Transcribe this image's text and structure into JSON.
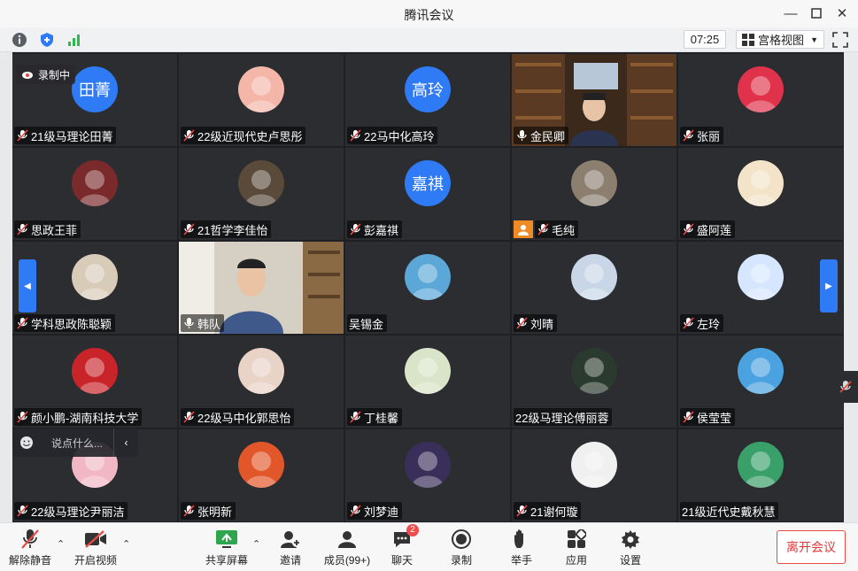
{
  "window": {
    "title": "腾讯会议"
  },
  "toolbar": {
    "timer": "07:25",
    "view_label": "宫格视图"
  },
  "recording": {
    "label": "录制中"
  },
  "chat": {
    "placeholder": "说点什么..."
  },
  "participants": [
    {
      "name": "21级马理论田菁",
      "avatar_text": "田菁",
      "kind": "text",
      "mic": "muted"
    },
    {
      "name": "22级近现代史卢思彤",
      "avatar_text": "",
      "kind": "photo",
      "color": "#f4b6a8",
      "mic": "muted"
    },
    {
      "name": "22马中化高玲",
      "avatar_text": "高玲",
      "kind": "text",
      "mic": "muted"
    },
    {
      "name": "金民卿",
      "avatar_text": "",
      "kind": "video",
      "mic": "on"
    },
    {
      "name": "张丽",
      "avatar_text": "",
      "kind": "photo",
      "color": "#e0334b",
      "mic": "muted"
    },
    {
      "name": "思政王菲",
      "avatar_text": "",
      "kind": "photo",
      "color": "#7a2a2a",
      "mic": "muted"
    },
    {
      "name": "21哲学李佳怡",
      "avatar_text": "",
      "kind": "photo",
      "color": "#5a4a3a",
      "mic": "muted"
    },
    {
      "name": "彭嘉祺",
      "avatar_text": "嘉祺",
      "kind": "text",
      "mic": "muted"
    },
    {
      "name": "毛纯",
      "avatar_text": "",
      "kind": "photo",
      "color": "#8c7f70",
      "mic": "muted"
    },
    {
      "name": "盛阿莲",
      "avatar_text": "",
      "kind": "photo",
      "color": "#f3e3c8",
      "mic": "muted"
    },
    {
      "name": "学科思政陈聪颖",
      "avatar_text": "",
      "kind": "photo",
      "color": "#d8cbb8",
      "mic": "muted"
    },
    {
      "name": "韩队",
      "avatar_text": "",
      "kind": "video2",
      "mic": "on"
    },
    {
      "name": "吴锡金",
      "avatar_text": "",
      "kind": "photo",
      "color": "#5aa7d8",
      "mic": "none"
    },
    {
      "name": "刘晴",
      "avatar_text": "",
      "kind": "photo",
      "color": "#c9d6e8",
      "mic": "muted"
    },
    {
      "name": "左玲",
      "avatar_text": "",
      "kind": "photo",
      "color": "#d6e6ff",
      "mic": "muted"
    },
    {
      "name": "颜小鹏-湖南科技大学",
      "avatar_text": "",
      "kind": "photo",
      "color": "#c8242a",
      "mic": "muted"
    },
    {
      "name": "22级马中化郭思怡",
      "avatar_text": "",
      "kind": "photo",
      "color": "#e9d2c6",
      "mic": "muted"
    },
    {
      "name": "丁桂馨",
      "avatar_text": "",
      "kind": "photo",
      "color": "#d9e4c8",
      "mic": "muted"
    },
    {
      "name": "22级马理论傅丽蓉",
      "avatar_text": "",
      "kind": "photo",
      "color": "#2b3a2f",
      "mic": "none"
    },
    {
      "name": "侯莹莹",
      "avatar_text": "",
      "kind": "photo",
      "color": "#4aa3e0",
      "mic": "muted"
    },
    {
      "name": "22级马理论尹丽洁",
      "avatar_text": "",
      "kind": "photo",
      "color": "#f2b7c4",
      "mic": "muted"
    },
    {
      "name": "张明新",
      "avatar_text": "",
      "kind": "photo",
      "color": "#e2572a",
      "mic": "muted"
    },
    {
      "name": "刘梦迪",
      "avatar_text": "",
      "kind": "photo",
      "color": "#3a2f5a",
      "mic": "muted"
    },
    {
      "name": "21谢何璇",
      "avatar_text": "",
      "kind": "photo",
      "color": "#f0f0f0",
      "mic": "muted"
    },
    {
      "name": "21级近代史戴秋慧",
      "avatar_text": "",
      "kind": "photo",
      "color": "#3aa06a",
      "mic": "none"
    }
  ],
  "bottombar": {
    "unmute": "解除静音",
    "start_video": "开启视频",
    "share_screen": "共享屏幕",
    "invite": "邀请",
    "members": "成员(99+)",
    "chat": "聊天",
    "chat_badge": "2",
    "record": "录制",
    "raise_hand": "举手",
    "apps": "应用",
    "settings": "设置",
    "leave": "离开会议"
  }
}
